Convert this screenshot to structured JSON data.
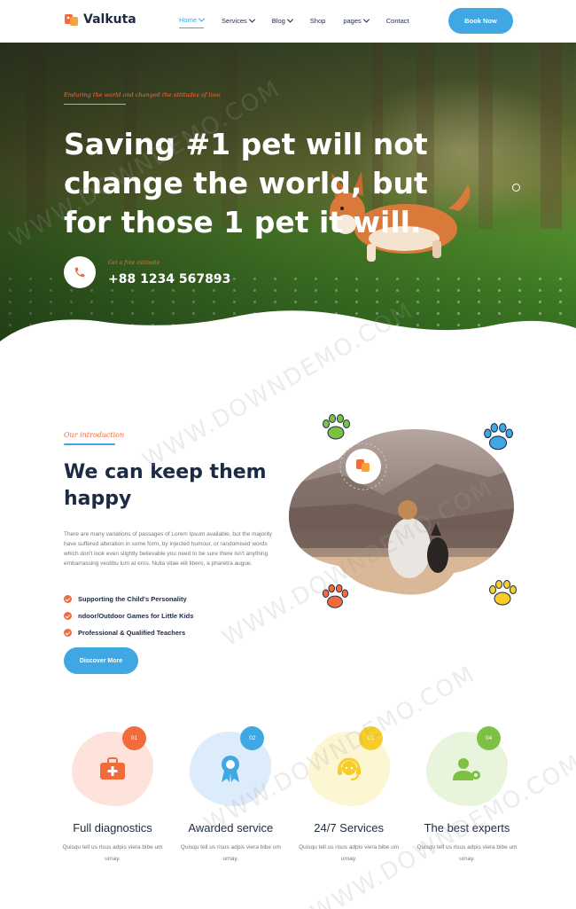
{
  "brand": {
    "name": "Valkuta"
  },
  "nav": {
    "items": [
      {
        "label": "Home",
        "dropdown": true,
        "active": true
      },
      {
        "label": "Services",
        "dropdown": true
      },
      {
        "label": "Blog",
        "dropdown": true
      },
      {
        "label": "Shop",
        "dropdown": false
      },
      {
        "label": "pages",
        "dropdown": true
      },
      {
        "label": "Contact",
        "dropdown": false
      }
    ],
    "cta": "Book Now"
  },
  "hero": {
    "tagline": "Enduring the world and changed the attitudes of love",
    "title": "Saving #1 pet will not change the world, but for those 1 pet it will.",
    "phone_label": "Get a free estimate",
    "phone": "+88 1234 567893"
  },
  "intro": {
    "tag": "Our introduction",
    "title": "We can keep them happy",
    "body": "There are many variations of passages of Lorem Ipsum available, but the majority have suffered alteration in some form, by injected humour, or randomised words which don't look even slightly believable you need to be sure there isn't anything embarrassing vestibu lum at eros. Nulla vitae elit libero, a pharetra augue.",
    "checks": [
      "Supporting the Child's Personality",
      "ndoor/Outdoor Games for Little Kids",
      "Professional & Qualified Teachers"
    ],
    "button": "Discover More"
  },
  "services": [
    {
      "num": "01",
      "title": "Full diagnostics",
      "text": "Quisqu tell us risus adpis viera bibe um urnay.",
      "icon": "medical-kit-icon",
      "blob": "#fde3dc",
      "accent": "#f26b3a"
    },
    {
      "num": "02",
      "title": "Awarded service",
      "text": "Quisqu tell us risus adpis viera bibe um urnay.",
      "icon": "award-badge-icon",
      "blob": "#dcecfb",
      "accent": "#3fa7e3"
    },
    {
      "num": "03",
      "title": "24/7 Services",
      "text": "Quisqu tell us risus adpis viera bibe um urnay.",
      "icon": "headset-icon",
      "blob": "#fdf6d3",
      "accent": "#f7cd2a"
    },
    {
      "num": "04",
      "title": "The best experts",
      "text": "Quisqu tell us risus adpis viera bibe um urnay.",
      "icon": "expert-gear-icon",
      "blob": "#e8f4dc",
      "accent": "#7cc142"
    }
  ],
  "colors": {
    "primary": "#3fa7e3",
    "accent": "#f26b3a",
    "heading": "#1d2a44"
  },
  "watermark": "WWW.DOWNDEMO.COM"
}
